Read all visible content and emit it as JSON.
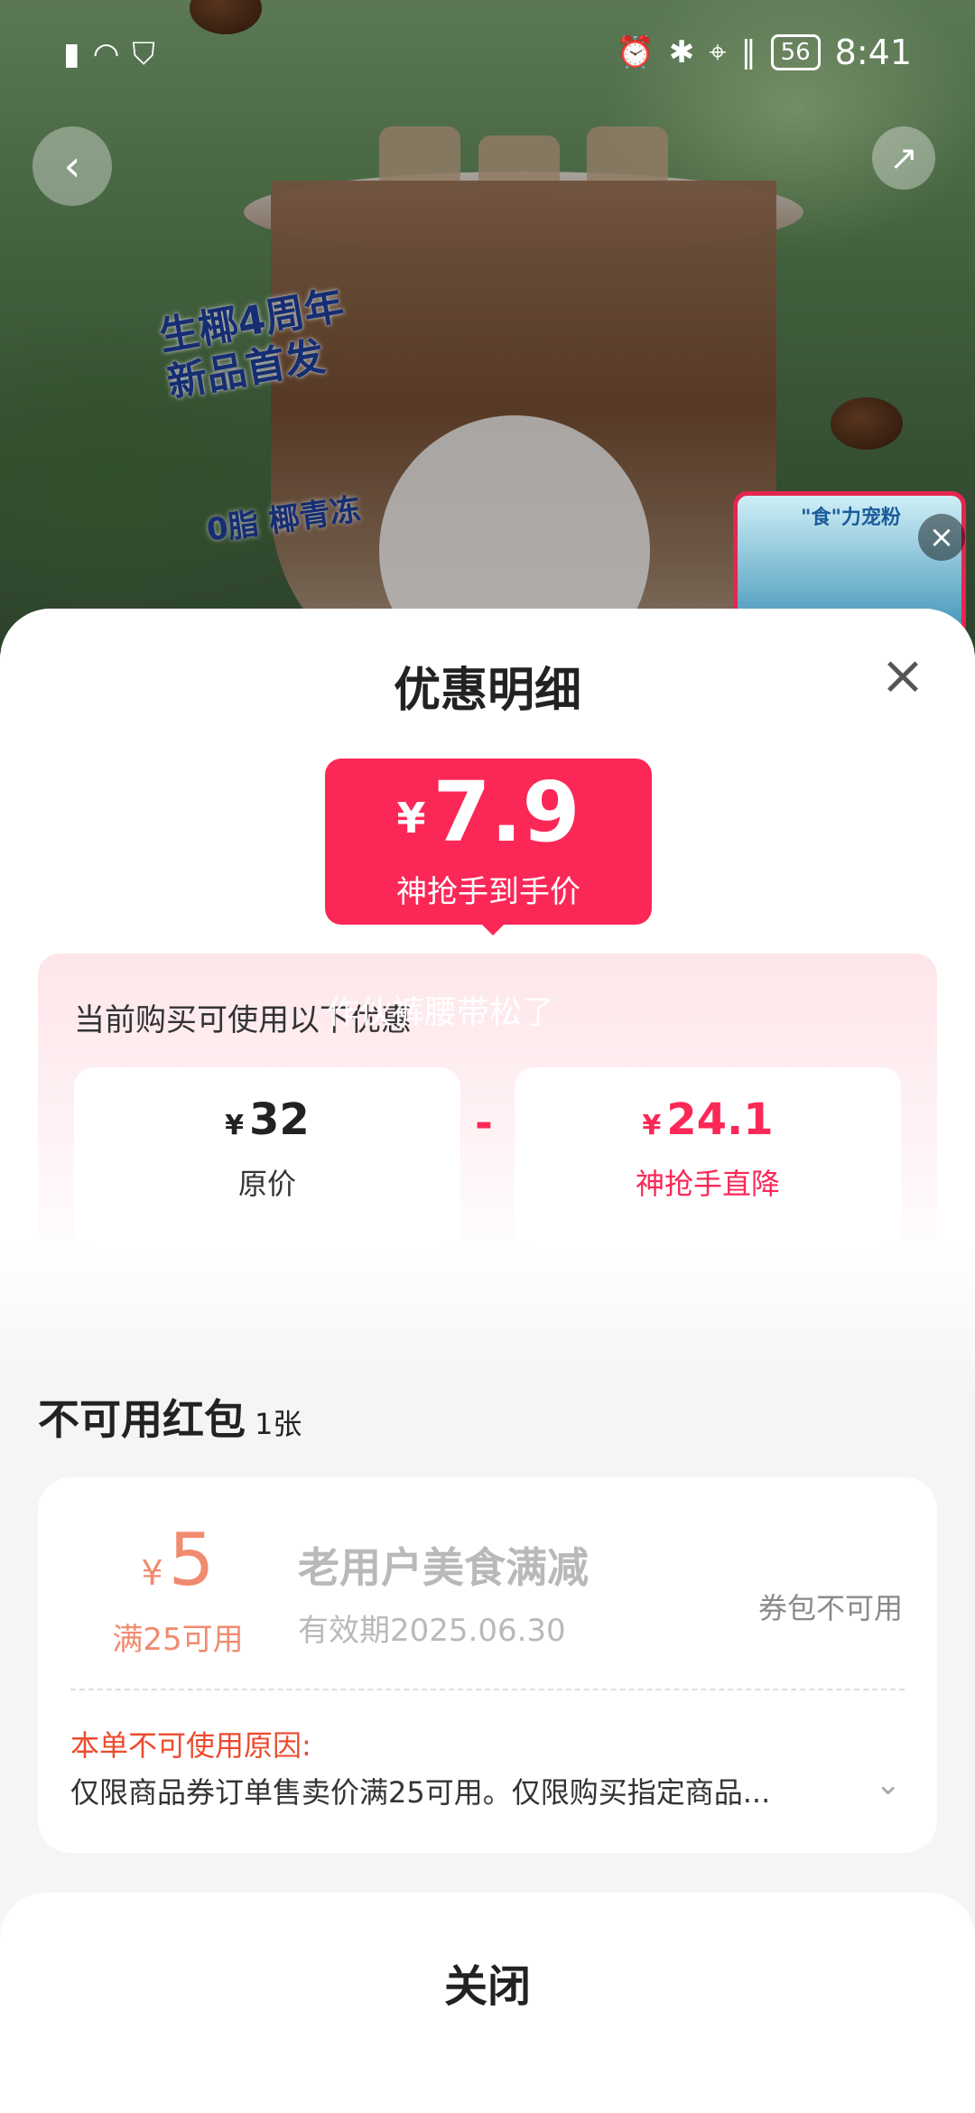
{
  "status_bar": {
    "left_icons": [
      "alert-icon",
      "wifi-icon",
      "vpn-shield-icon"
    ],
    "right_icons": [
      "alarm-icon",
      "bluetooth-icon",
      "location-icon",
      "vibrate-icon"
    ],
    "battery": "56",
    "time": "8:41"
  },
  "hero": {
    "anniversary_line1": "生椰4周年",
    "anniversary_line2": "新品首发",
    "zero_fat_badge": "0脂 椰青冻",
    "ad_card_title": "\"食\"力宠粉"
  },
  "sheet": {
    "title": "优惠明细",
    "final_price": {
      "currency": "¥",
      "amount": "7.9",
      "label": "神抢手到手价"
    },
    "discount": {
      "hint": "当前购买可使用以下优惠",
      "watermark": "作伙裤腰带松了",
      "original": {
        "currency": "¥",
        "amount": "32",
        "label": "原价"
      },
      "operator": "-",
      "reduction": {
        "currency": "¥",
        "amount": "24.1",
        "label": "神抢手直降"
      }
    },
    "unavailable": {
      "title": "不可用红包",
      "count": "1张",
      "coupon": {
        "currency": "¥",
        "amount": "5",
        "condition": "满25可用",
        "name": "老用户美食满减",
        "validity": "有效期2025.06.30",
        "status": "券包不可用",
        "reason_title": "本单不可使用原因:",
        "reason_text": "仅限商品券订单售卖价满25可用。仅限购买指定商品..."
      }
    },
    "close_button": "关闭"
  },
  "colors": {
    "accent": "#fb2857",
    "coupon_amount": "#f08b6f",
    "reason": "#ec4b2f"
  }
}
